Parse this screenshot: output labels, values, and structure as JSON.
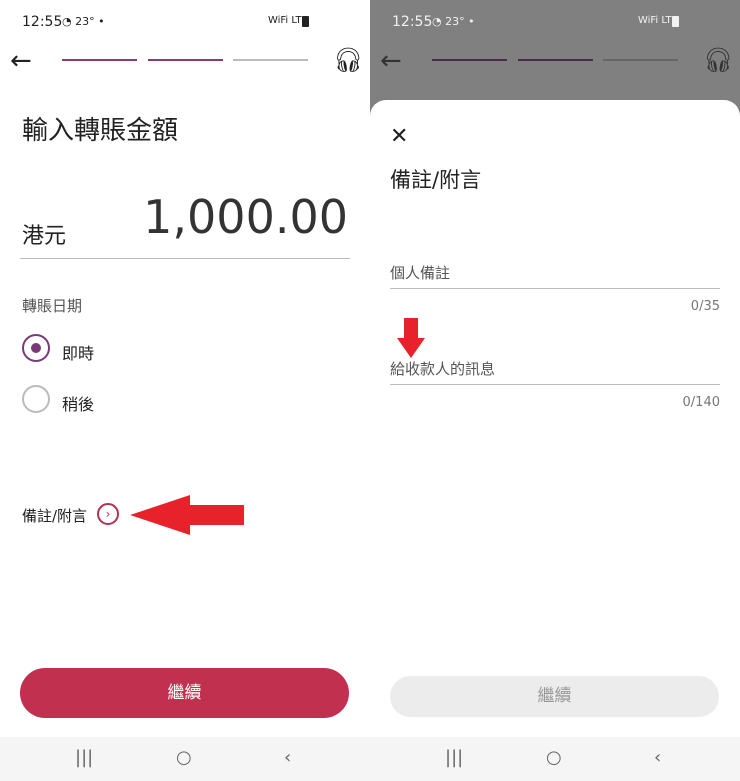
{
  "colors": {
    "accent": "#c2304f",
    "radio": "#7a3a78",
    "arrow": "#e8222a"
  },
  "left": {
    "status": {
      "time": "12:55",
      "icons": "◔ 23° •",
      "system": "WiFi LTE",
      "battery": "battery-icon"
    },
    "title": "輸入轉賬金額",
    "currency": "港元",
    "amount": "1,000.00",
    "date_label": "轉賬日期",
    "options": [
      "即時",
      "稍後"
    ],
    "selected_option": "即時",
    "memo_label": "備註/附言",
    "continue_label": "繼續"
  },
  "right": {
    "status": {
      "time": "12:55",
      "icons": "◔ 23° •",
      "system": "WiFi LTE"
    },
    "sheet_title": "備註/附言",
    "fields": [
      {
        "placeholder": "個人備註",
        "counter": "0/35"
      },
      {
        "placeholder": "給收款人的訊息",
        "counter": "0/140"
      }
    ],
    "continue_label": "繼續"
  },
  "nav": {
    "recent": "|||",
    "home": "○",
    "back": "‹"
  }
}
